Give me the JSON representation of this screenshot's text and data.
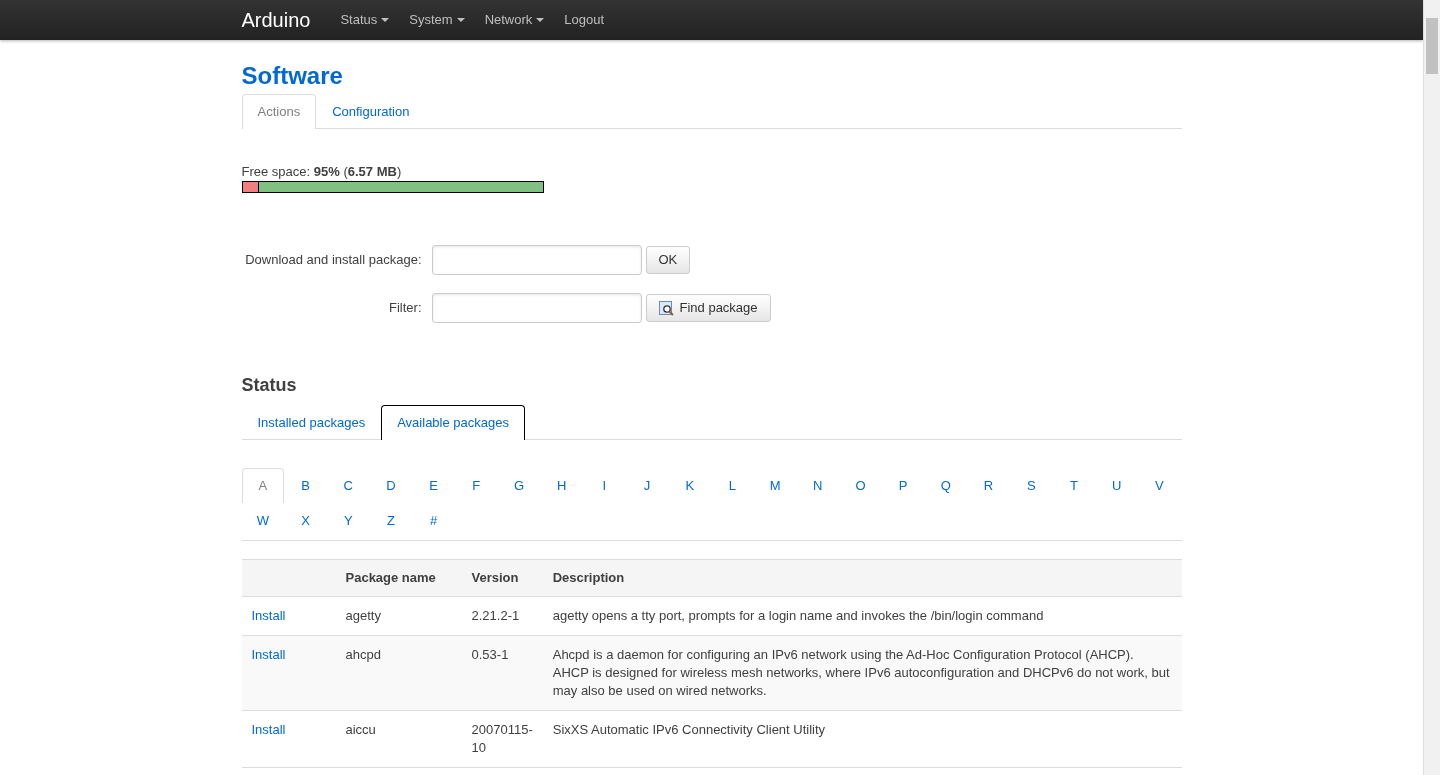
{
  "navbar": {
    "brand": "Arduino",
    "menus": [
      {
        "label": "Status",
        "dropdown": true
      },
      {
        "label": "System",
        "dropdown": true
      },
      {
        "label": "Network",
        "dropdown": true
      },
      {
        "label": "Logout",
        "dropdown": false
      }
    ]
  },
  "page_title": "Software",
  "tabs": [
    {
      "label": "Actions",
      "selected": true
    },
    {
      "label": "Configuration",
      "selected": false
    }
  ],
  "free_space": {
    "text": "Free space: **95%** (**6.57 MB**)",
    "level": 0.95
  },
  "download": {
    "label": "Download and install package:",
    "button": "OK"
  },
  "filter": {
    "label": "Filter:",
    "button": "Find package"
  },
  "status_title": "Status",
  "status_tabs": [
    {
      "label": "Installed packages",
      "selected": false
    },
    {
      "label": "Available packages",
      "selected": true
    }
  ],
  "letters": [
    {
      "label": "A",
      "selected": true
    },
    {
      "label": "B",
      "selected": false
    },
    {
      "label": "C",
      "selected": false
    },
    {
      "label": "D",
      "selected": false
    },
    {
      "label": "E",
      "selected": false
    },
    {
      "label": "F",
      "selected": false
    },
    {
      "label": "G",
      "selected": false
    },
    {
      "label": "H",
      "selected": false
    },
    {
      "label": "I",
      "selected": false
    },
    {
      "label": "J",
      "selected": false
    },
    {
      "label": "K",
      "selected": false
    },
    {
      "label": "L",
      "selected": false
    },
    {
      "label": "M",
      "selected": false
    },
    {
      "label": "N",
      "selected": false
    },
    {
      "label": "O",
      "selected": false
    },
    {
      "label": "P",
      "selected": false
    },
    {
      "label": "Q",
      "selected": false
    },
    {
      "label": "R",
      "selected": false
    },
    {
      "label": "S",
      "selected": false
    },
    {
      "label": "T",
      "selected": false
    },
    {
      "label": "U",
      "selected": false
    },
    {
      "label": "V",
      "selected": false
    },
    {
      "label": "W",
      "selected": false
    },
    {
      "label": "X",
      "selected": false
    },
    {
      "label": "Y",
      "selected": false
    },
    {
      "label": "Z",
      "selected": false
    },
    {
      "label": "#",
      "selected": false
    }
  ],
  "table": {
    "columns": [
      "Package name",
      "Version",
      "Description"
    ],
    "rows": [
      {
        "action": "Install",
        "name": "agetty",
        "version": "2.21.2-1",
        "description": "agetty opens a tty port, prompts for a login name and invokes the /bin/login command"
      },
      {
        "action": "Install",
        "name": "ahcpd",
        "version": "0.53-1",
        "description": "Ahcpd is a daemon for configuring an IPv6 network using the Ad-Hoc Configuration Protocol (AHCP). AHCP is designed for wireless mesh networks, where IPv6 autoconfiguration and DHCPv6 do not work, but may also be used on wired networks."
      },
      {
        "action": "Install",
        "name": "aiccu",
        "version": "20070115-10",
        "description": "SixXS Automatic IPv6 Connectivity Client Utility"
      }
    ]
  }
}
